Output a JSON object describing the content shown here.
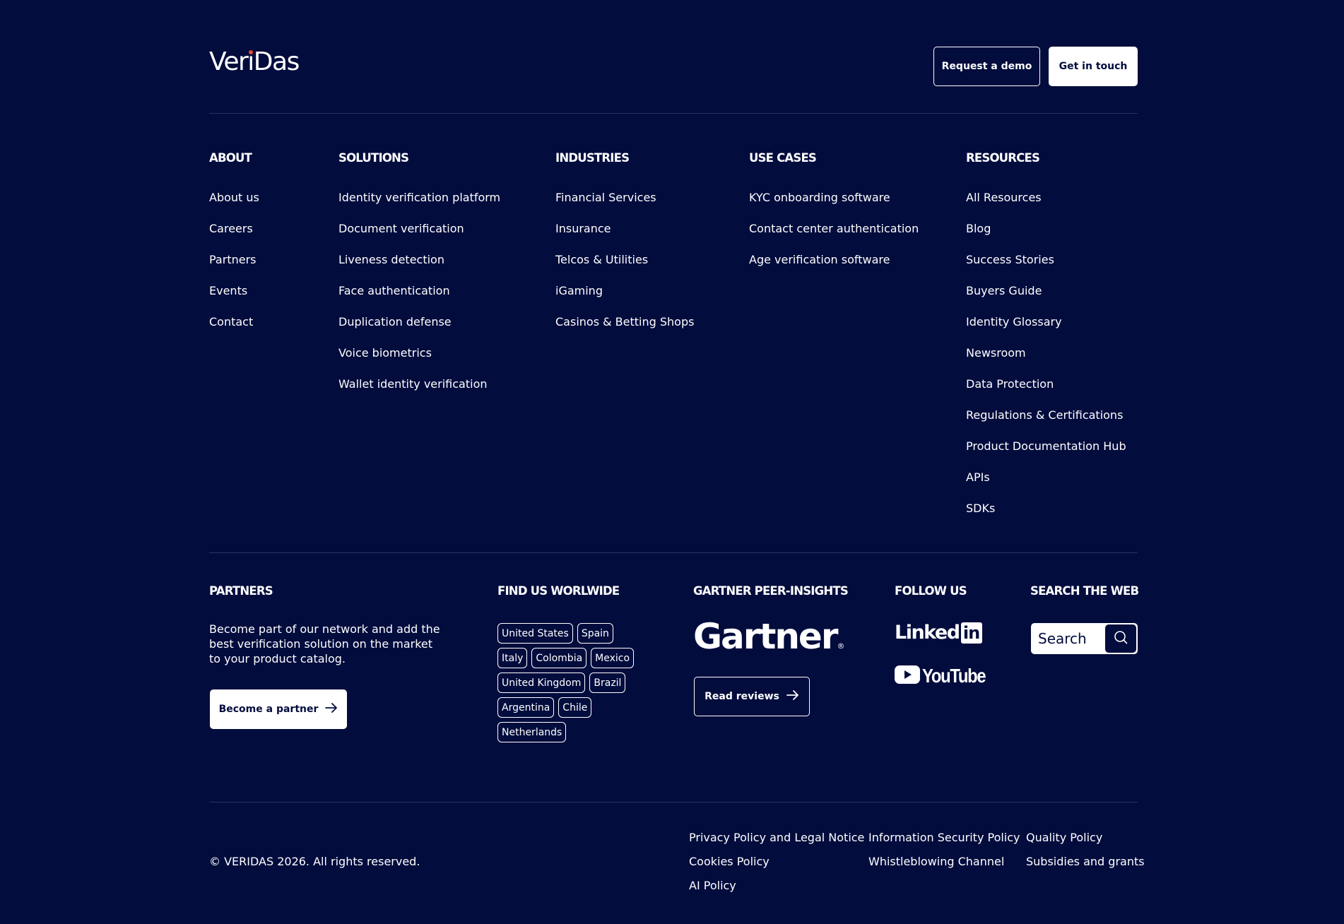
{
  "brand": {
    "logo_pre": "Ver",
    "logo_i": "i",
    "logo_post": "Das",
    "accent_color": "#e64a3b",
    "background": "#020c3d"
  },
  "header": {
    "request_demo": "Request a demo",
    "get_in_touch": "Get in touch"
  },
  "columns": {
    "about": {
      "title": "ABOUT",
      "items": [
        "About us",
        "Careers",
        "Partners",
        "Events",
        "Contact"
      ]
    },
    "solutions": {
      "title": "SOLUTIONS",
      "items": [
        "Identity verification platform",
        "Document verification",
        "Liveness detection",
        "Face authentication",
        "Duplication defense",
        "Voice biometrics",
        "Wallet identity verification"
      ]
    },
    "industries": {
      "title": "INDUSTRIES",
      "items": [
        "Financial Services",
        "Insurance",
        "Telcos & Utilities",
        "iGaming",
        "Casinos & Betting Shops"
      ]
    },
    "use_cases": {
      "title": "USE CASES",
      "items": [
        "KYC onboarding software",
        "Contact center authentication",
        "Age verification software"
      ]
    },
    "resources": {
      "title": "RESOURCES",
      "items": [
        "All Resources",
        "Blog",
        "Success Stories",
        "Buyers Guide",
        "Identity Glossary",
        "Newsroom",
        "Data Protection",
        "Regulations & Certifications",
        "Product Documentation Hub",
        "APIs",
        "SDKs"
      ]
    }
  },
  "partners": {
    "title": "PARTNERS",
    "text": "Become part of our network and add the best verification solution on the market to your product catalog.",
    "button": "Become a partner",
    "button_icon": "arrow-right-icon"
  },
  "worldwide": {
    "title": "FIND US WORLWIDE",
    "rows": [
      [
        "United States",
        "Spain"
      ],
      [
        "Italy",
        "Colombia",
        "Mexico"
      ],
      [
        "United Kingdom",
        "Brazil"
      ],
      [
        "Argentina",
        "Chile"
      ],
      [
        "Netherlands"
      ]
    ]
  },
  "gartner": {
    "title": "GARTNER PEER-INSIGHTS",
    "logo": "Gartner",
    "logo_mark": "®",
    "button": "Read reviews",
    "button_icon": "arrow-right-icon"
  },
  "follow": {
    "title": "FOLLOW US",
    "linkedin_text": "Linked",
    "linkedin_in": "in",
    "youtube_text": "YouTube"
  },
  "search": {
    "title": "SEARCH THE WEB",
    "placeholder": "Search",
    "icon": "search-icon"
  },
  "footer": {
    "copyright": "© VERIDAS 2026. All rights reserved.",
    "legal": {
      "privacy": "Privacy Policy and Legal Notice",
      "infosec": "Information Security Policy",
      "quality": "Quality Policy",
      "cookies": "Cookies Policy",
      "whistleblowing": "Whistleblowing Channel",
      "subsidies": "Subsidies and grants",
      "ai": "AI Policy"
    }
  }
}
